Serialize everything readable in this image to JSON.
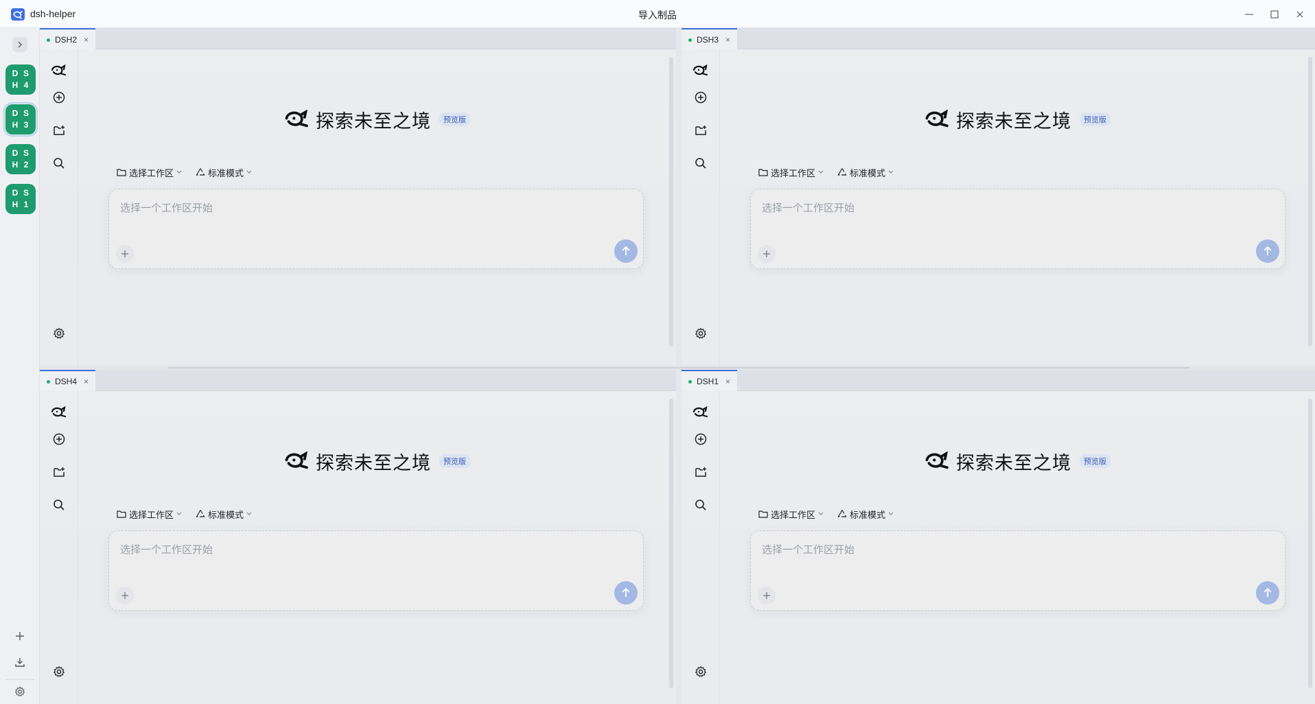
{
  "titlebar": {
    "app_name": "dsh-helper",
    "window_title": "导入制品",
    "buttons": [
      "minimize",
      "maximize",
      "close"
    ]
  },
  "rail": {
    "workspaces": [
      {
        "letters": [
          "D",
          "S",
          "H",
          "4"
        ],
        "active": false
      },
      {
        "letters": [
          "D",
          "S",
          "H",
          "3"
        ],
        "active": true
      },
      {
        "letters": [
          "D",
          "S",
          "H",
          "2"
        ],
        "active": false
      },
      {
        "letters": [
          "D",
          "S",
          "H",
          "1"
        ],
        "active": false
      }
    ],
    "accent_color": "#1e9b6f"
  },
  "panes": [
    {
      "tab_label": "DSH2",
      "hero_title": "探索未至之境",
      "badge": "预览版",
      "workspace_select": "选择工作区",
      "mode_select": "标准模式",
      "placeholder": "选择一个工作区开始"
    },
    {
      "tab_label": "DSH3",
      "hero_title": "探索未至之境",
      "badge": "预览版",
      "workspace_select": "选择工作区",
      "mode_select": "标准模式",
      "placeholder": "选择一个工作区开始"
    },
    {
      "tab_label": "DSH4",
      "hero_title": "探索未至之境",
      "badge": "预览版",
      "workspace_select": "选择工作区",
      "mode_select": "标准模式",
      "placeholder": "选择一个工作区开始"
    },
    {
      "tab_label": "DSH1",
      "hero_title": "探索未至之境",
      "badge": "预览版",
      "workspace_select": "选择工作区",
      "mode_select": "标准模式",
      "placeholder": "选择一个工作区开始"
    }
  ],
  "colors": {
    "tab_accent": "#3e6fd8",
    "status_dot": "#18b06b",
    "send_button": "#a4b8e4"
  }
}
